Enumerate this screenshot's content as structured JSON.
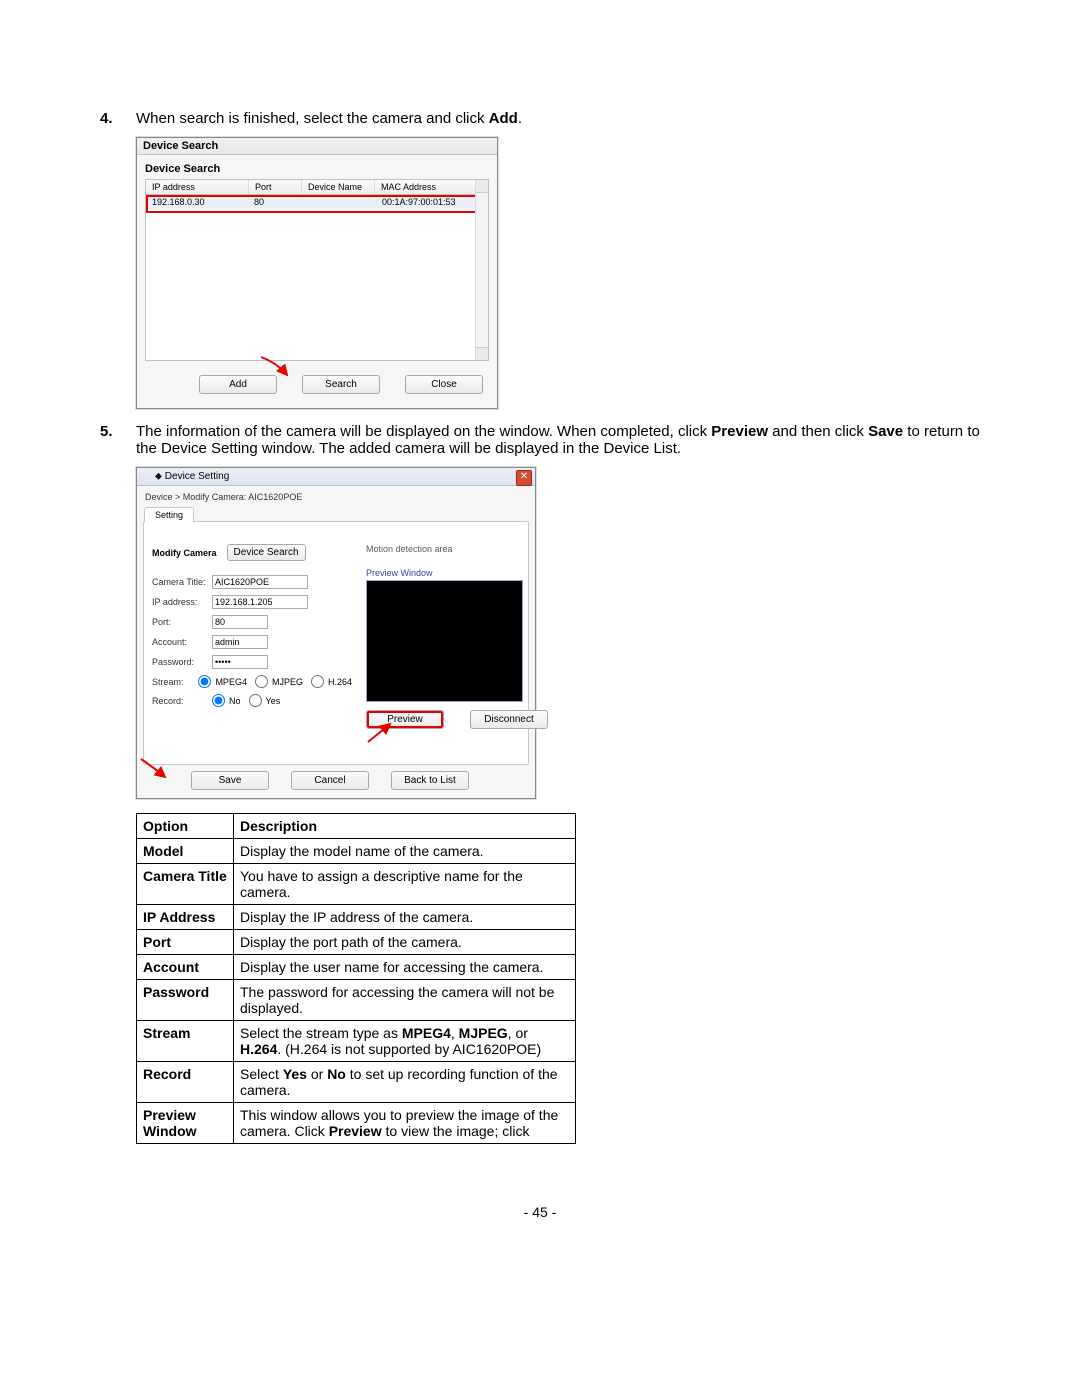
{
  "step4": {
    "num": "4.",
    "text_a": "When search is finished, select the camera and click ",
    "text_b_bold": "Add",
    "text_c": "."
  },
  "device_search": {
    "window_title": "Device Search",
    "panel_title": "Device Search",
    "headers": {
      "ip": "IP address",
      "port": "Port",
      "name": "Device Name",
      "mac": "MAC Address"
    },
    "row1": {
      "ip": "192.168.0.30",
      "port": "80",
      "name": "",
      "mac": "00:1A:97:00:01:53"
    },
    "buttons": {
      "add": "Add",
      "search": "Search",
      "close": "Close"
    }
  },
  "step5": {
    "num": "5.",
    "t1": "The information of the camera will be displayed on the window. When completed, click ",
    "b1": "Preview",
    "t2": " and then click ",
    "b2": "Save",
    "t3": " to return to the Device Setting window. The added camera will be displayed in the Device List."
  },
  "device_setting": {
    "window_title": "Device Setting",
    "breadcrumb": "Device > Modify Camera: AIC1620POE",
    "tab": "Setting",
    "section": "Modify Camera",
    "device_search_btn": "Device Search",
    "motion_link": "Motion detection area",
    "fields": {
      "title_lbl": "Camera Title:",
      "title_val": "AIC1620POE",
      "ip_lbl": "IP address:",
      "ip_val": "192.168.1.205",
      "port_lbl": "Port:",
      "port_val": "80",
      "acct_lbl": "Account:",
      "acct_val": "admin",
      "pwd_lbl": "Password:",
      "pwd_val": "•••••",
      "stream_lbl": "Stream:",
      "stream_mpeg4": "MPEG4",
      "stream_mjpeg": "MJPEG",
      "stream_h264": "H.264",
      "rec_lbl": "Record:",
      "rec_no": "No",
      "rec_yes": "Yes"
    },
    "preview_label": "Preview Window",
    "preview_btn": "Preview",
    "disconnect_btn": "Disconnect",
    "save_btn": "Save",
    "cancel_btn": "Cancel",
    "back_btn": "Back to List"
  },
  "table": {
    "h_option": "Option",
    "h_desc": "Description",
    "rows": [
      {
        "o": "Model",
        "d": [
          {
            "t": "Display the model name of the camera."
          }
        ]
      },
      {
        "o": "Camera Title",
        "d": [
          {
            "t": "You have to assign a descriptive name for the camera."
          }
        ]
      },
      {
        "o": "IP Address",
        "d": [
          {
            "t": "Display the IP address of the camera."
          }
        ]
      },
      {
        "o": "Port",
        "d": [
          {
            "t": "Display the port path of the camera."
          }
        ]
      },
      {
        "o": "Account",
        "d": [
          {
            "t": "Display the user name for accessing the camera."
          }
        ]
      },
      {
        "o": "Password",
        "d": [
          {
            "t": "The password for accessing the camera will not be displayed."
          }
        ]
      },
      {
        "o": "Stream",
        "d": [
          {
            "t": "Select the stream type as "
          },
          {
            "b": "MPEG4"
          },
          {
            "t": ", "
          },
          {
            "b": "MJPEG"
          },
          {
            "t": ", or "
          },
          {
            "b": "H.264"
          },
          {
            "t": ". (H.264 is not supported by AIC1620POE)"
          }
        ]
      },
      {
        "o": "Record",
        "d": [
          {
            "t": "Select "
          },
          {
            "b": "Yes"
          },
          {
            "t": " or "
          },
          {
            "b": "No"
          },
          {
            "t": " to set up recording function of the camera."
          }
        ]
      },
      {
        "o": "Preview Window",
        "d": [
          {
            "t": "This window allows you to preview the image of the camera. Click "
          },
          {
            "b": "Preview"
          },
          {
            "t": " to view the image; click"
          }
        ]
      }
    ]
  },
  "page_num": "- 45 -"
}
